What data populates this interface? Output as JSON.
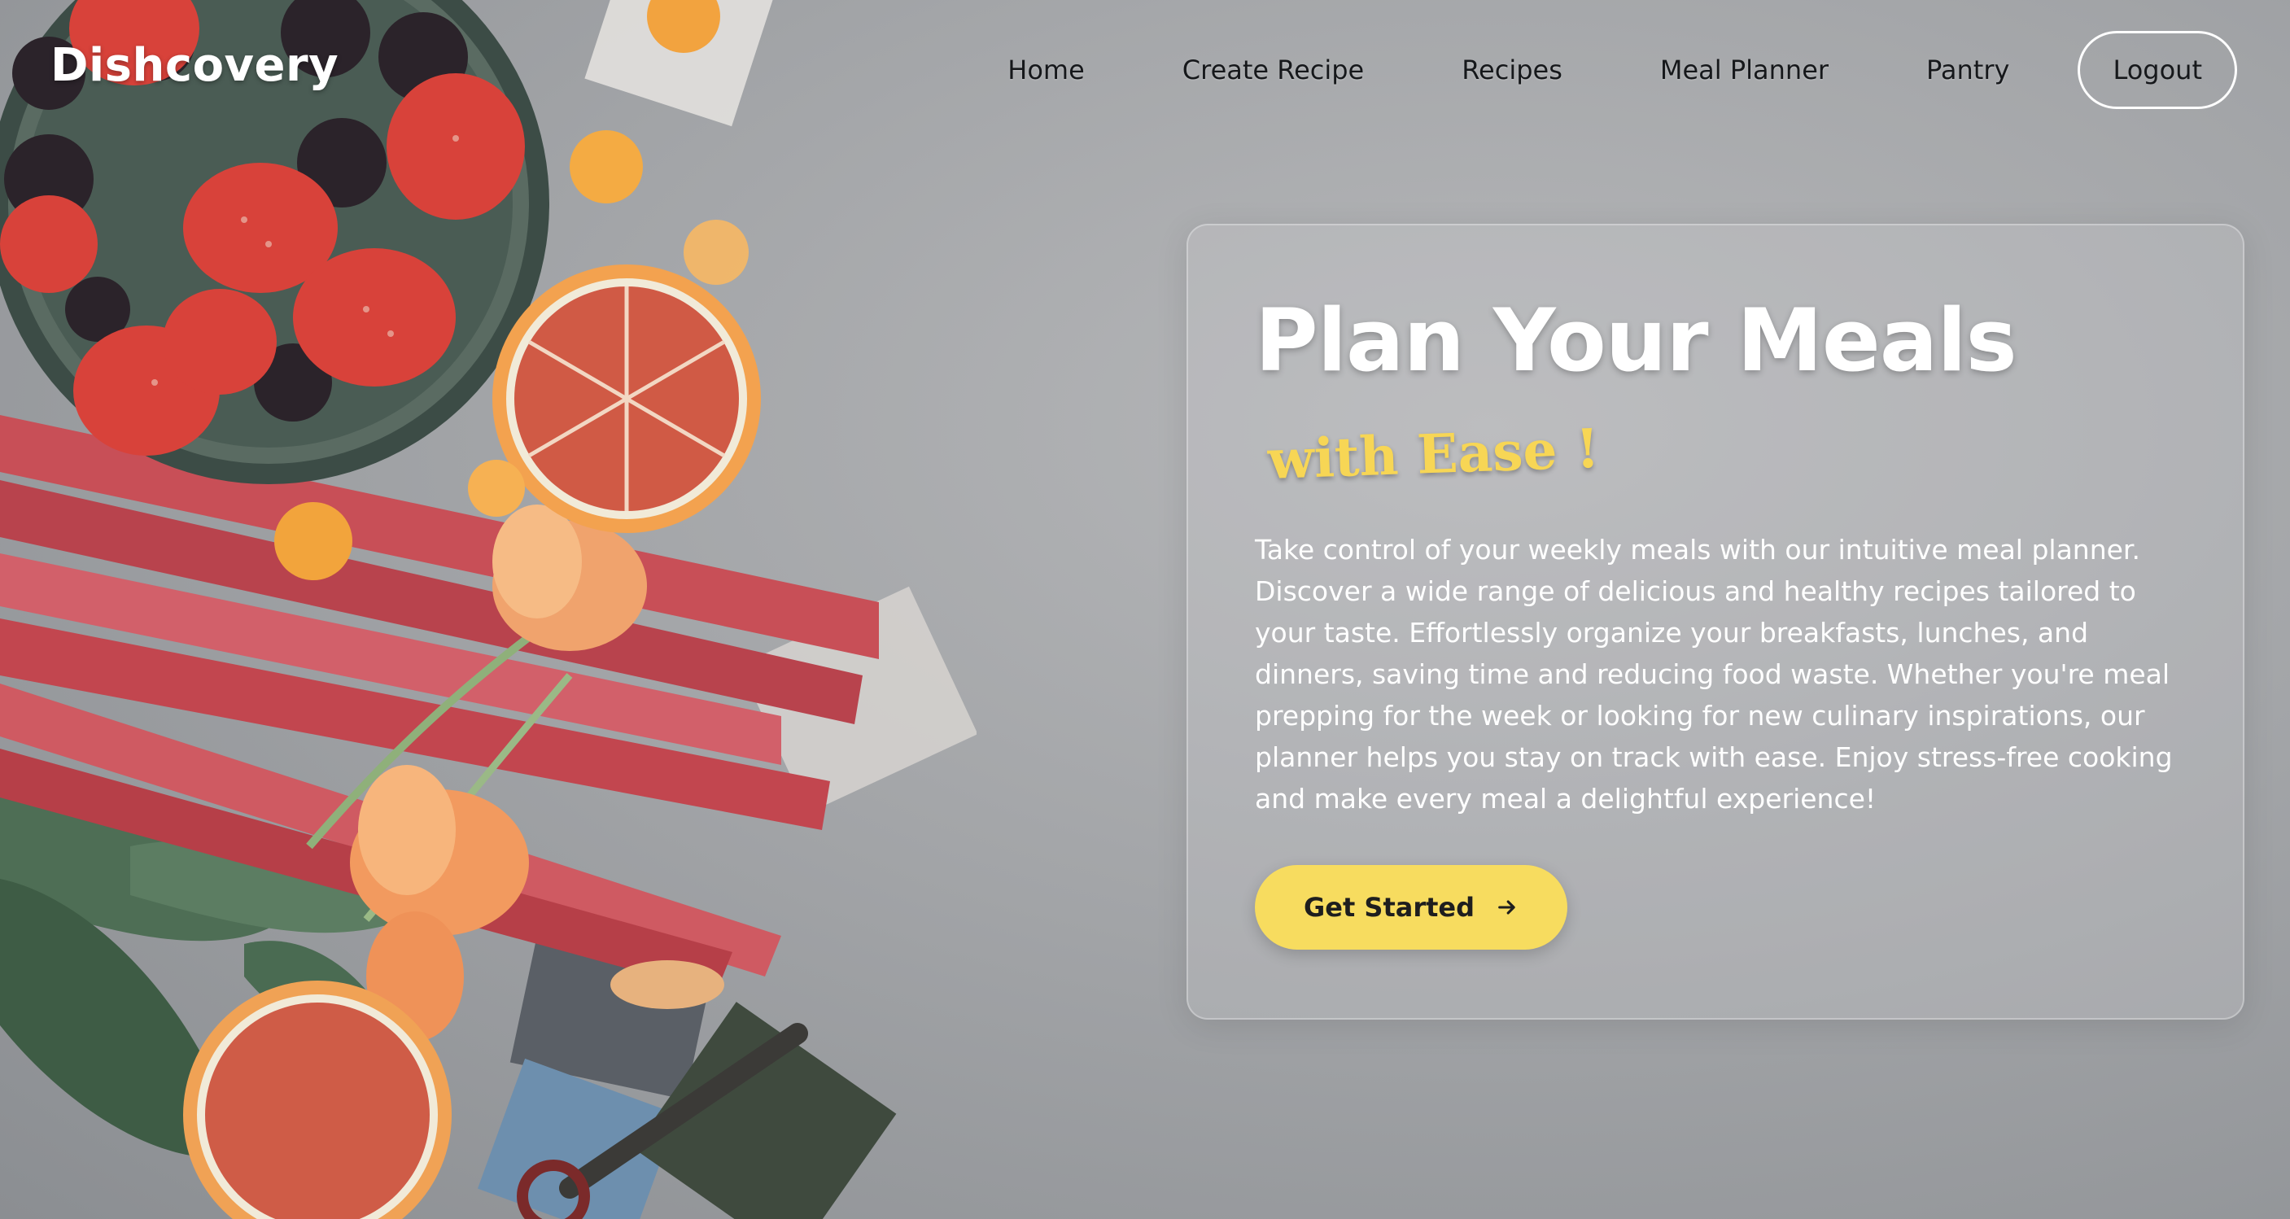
{
  "header": {
    "logo": "Dishcovery",
    "nav": {
      "home": "Home",
      "create_recipe": "Create Recipe",
      "recipes": "Recipes",
      "meal_planner": "Meal Planner",
      "pantry": "Pantry"
    },
    "logout_label": "Logout"
  },
  "hero": {
    "title": "Plan Your Meals",
    "subtitle": "with Ease !",
    "description": "Take control of your weekly meals with our intuitive meal planner. Discover a wide range of delicious and healthy recipes tailored to your taste. Effortlessly organize your breakfasts, lunches, and dinners, saving time and reducing food waste. Whether you're meal prepping for the week or looking for new culinary inspirations, our planner helps you stay on track with ease. Enjoy stress-free cooking and make every meal a delightful experience!",
    "cta_label": "Get Started",
    "cta_icon": "arrow-right-icon"
  },
  "colors": {
    "accent_yellow": "#f7dc5f",
    "subtitle_yellow": "#f7d655",
    "background_gray": "#a3a5a8"
  }
}
